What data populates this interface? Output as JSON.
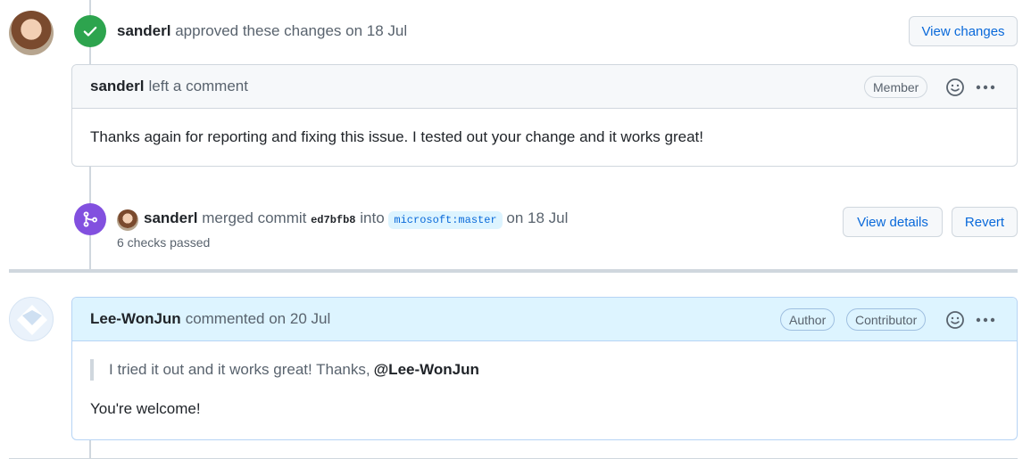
{
  "review": {
    "user": "sanderl",
    "action": "approved these changes",
    "date": "on 18 Jul",
    "button": "View changes"
  },
  "comment1": {
    "user": "sanderl",
    "action": "left a comment",
    "label": "Member",
    "body": "Thanks again for reporting and fixing this issue. I tested out your change and it works great!"
  },
  "merge": {
    "user": "sanderl",
    "action": "merged commit",
    "commit": "ed7bfb8",
    "into": "into",
    "branch": "microsoft:master",
    "date": "on 18 Jul",
    "checks": "6 checks passed",
    "view_details": "View details",
    "revert": "Revert"
  },
  "comment2": {
    "user": "Lee-WonJun",
    "action": "commented on 20 Jul",
    "labels": [
      "Author",
      "Contributor"
    ],
    "quote_text": "I tried it out and it works great! Thanks,",
    "quote_mention": "@Lee-WonJun",
    "body": "You're welcome!"
  },
  "colors": {
    "approved": "#2da44e",
    "merged": "#8250df",
    "link": "#0969da"
  },
  "icons": [
    "check-icon",
    "merge-icon",
    "smiley-icon",
    "kebab-icon"
  ]
}
